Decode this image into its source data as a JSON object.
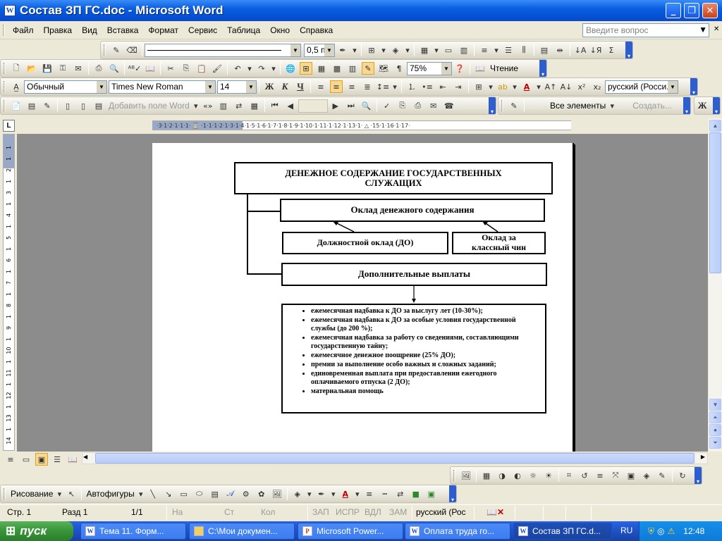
{
  "window": {
    "title": "Состав ЗП ГС.doc - Microsoft Word",
    "app_icon": "word-doc-icon",
    "controls": {
      "minimize": "_",
      "maximize": "❐",
      "close": "✕"
    }
  },
  "menubar": {
    "items": [
      "Файл",
      "Правка",
      "Вид",
      "Вставка",
      "Формат",
      "Сервис",
      "Таблица",
      "Окно",
      "Справка"
    ],
    "ask_placeholder": "Введите вопрос",
    "mdi_close": "✕"
  },
  "toolbars": {
    "drawing_table": {
      "line_weight": "0,5 пт"
    },
    "standard": {
      "zoom": "75%",
      "reading_label": "Чтение"
    },
    "formatting": {
      "style": "Обычный",
      "font": "Times New Roman",
      "size": "14",
      "bold": "Ж",
      "italic": "К",
      "underline": "Ч",
      "language": "русский (Росси."
    },
    "mailmerge": {
      "insert_field": "Добавить поле Word",
      "all_elements": "Все элементы",
      "create": "Создать...",
      "bold_short": "Ж"
    }
  },
  "ruler": {
    "corner": "L",
    "h_labels": "·3·1·2·1·1·1· ⌛ ·1·1·1·2·1·3·1·4·1·5·1·6·1·7·1·8·1·9·1·10·1·11·1·12·1·13·1· △ ·15·1·16·1·17·",
    "v_labels": [
      "1",
      "1",
      "2",
      "1",
      "3",
      "1",
      "4",
      "1",
      "5",
      "1",
      "6",
      "1",
      "7",
      "1",
      "8",
      "1",
      "9",
      "1",
      "10",
      "1",
      "11",
      "1",
      "12",
      "1",
      "13",
      "1",
      "14"
    ]
  },
  "document": {
    "heading": "ДЕНЕЖНОЕ СОДЕРЖАНИЕ ГОСУДАРСТВЕННЫХ СЛУЖАЩИХ",
    "salary_box": "Оклад денежного содержания",
    "position_salary": "Должностной оклад (ДО)",
    "rank_salary": "Оклад за классный чин",
    "additional": "Дополнительные выплаты",
    "payments": [
      "ежемесячная надбавка к ДО за выслугу лет (10-30%);",
      "ежемесячная надбавка к ДО за особые условия государственной службы (до 200 %);",
      "ежемесячная надбавка за работу со сведениями, составляющими государственную тайну;",
      "ежемесячное денежное поощрение (25% ДО);",
      "премии за выполнение особо важных и сложных заданий;",
      "единовременная выплата при предоставлении ежегодного оплачиваемого отпуска (2 ДО);",
      "материальная помощь"
    ]
  },
  "bottom_toolbar": {
    "drawing_label": "Рисование",
    "autoshapes_label": "Автофигуры"
  },
  "statusbar": {
    "page": "Стр. 1",
    "section": "Разд 1",
    "pages": "1/1",
    "at": "На",
    "line": "Ст",
    "col": "Кол",
    "rec": "ЗАП",
    "trk": "ИСПР",
    "ext": "ВДЛ",
    "ovr": "ЗАМ",
    "language": "русский (Рос"
  },
  "taskbar": {
    "start": "пуск",
    "tasks": [
      {
        "label": "Тема 11. Форм...",
        "icon": "word-doc-icon"
      },
      {
        "label": "C:\\Мои докумен...",
        "icon": "folder-icon"
      },
      {
        "label": "Microsoft Power...",
        "icon": "powerpoint-icon"
      },
      {
        "label": "Оплата труда го...",
        "icon": "word-doc-icon"
      },
      {
        "label": "Состав ЗП ГС.d...",
        "icon": "word-doc-icon"
      }
    ],
    "lang": "RU",
    "clock": "12:48"
  },
  "colors": {
    "titlebar": "#0454d8",
    "taskbar": "#245edb",
    "start": "#3c9a3c",
    "doc_bg": "#8c8c8c"
  }
}
